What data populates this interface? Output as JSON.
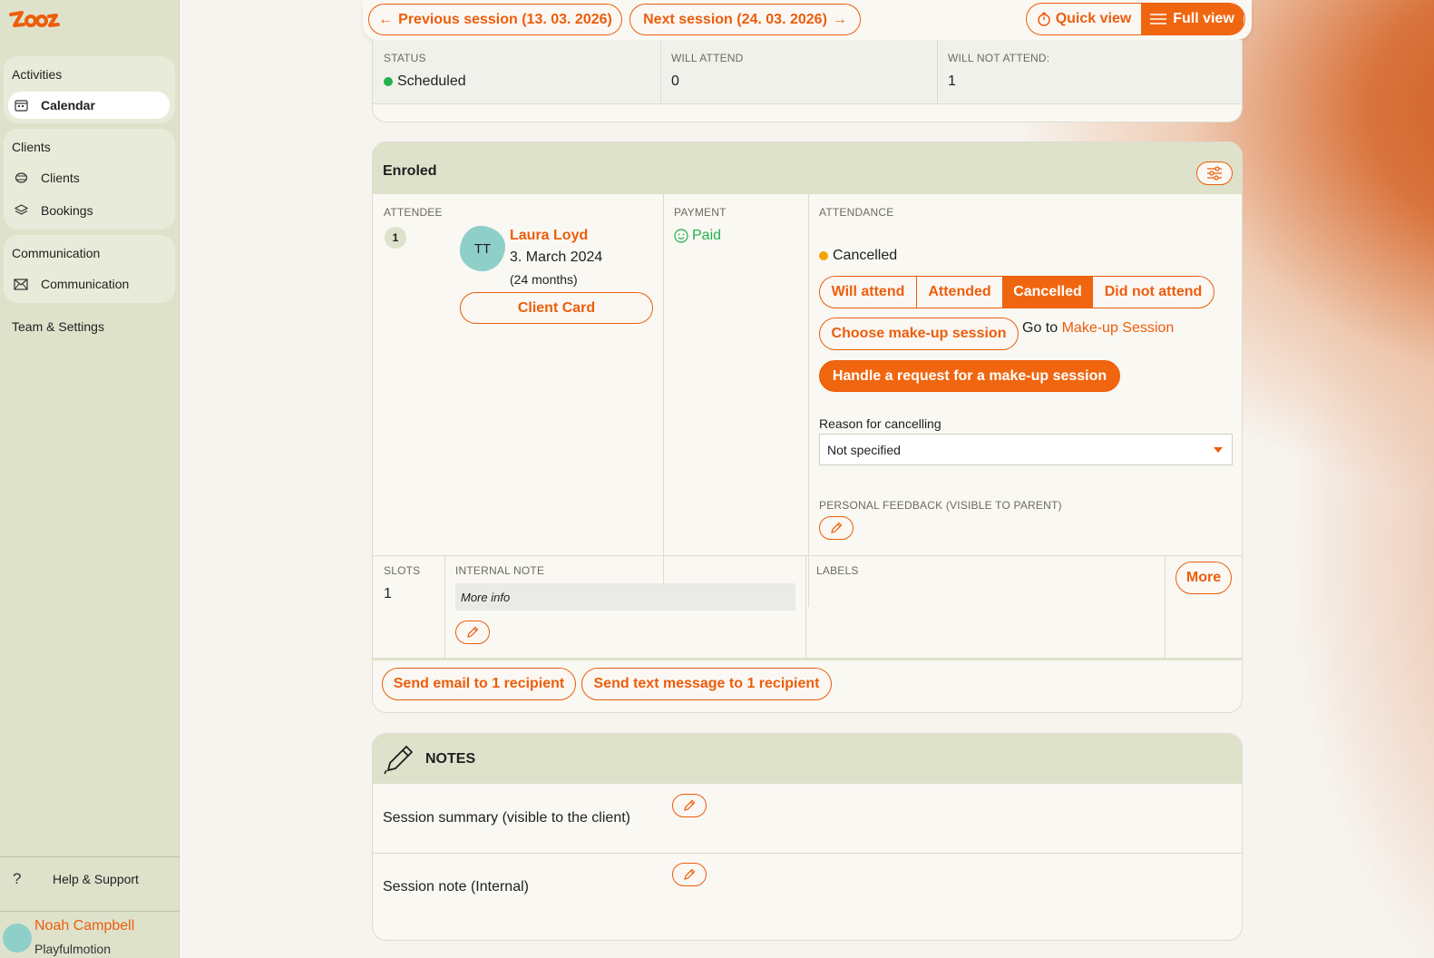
{
  "sidebar": {
    "logo_text": "zooza",
    "groups": [
      {
        "title": "Activities",
        "items": [
          {
            "label": "Calendar",
            "icon": "calendar-icon",
            "active": true
          }
        ]
      },
      {
        "title": "Clients",
        "items": [
          {
            "label": "Clients",
            "icon": "clients-icon"
          },
          {
            "label": "Bookings",
            "icon": "layers-icon"
          }
        ]
      },
      {
        "title": "Communication",
        "items": [
          {
            "label": "Communication",
            "icon": "envelope-icon"
          }
        ]
      }
    ],
    "team_settings": "Team & Settings",
    "help": "Help & Support",
    "user": {
      "name": "Noah Campbell",
      "org": "Playfulmotion"
    }
  },
  "topbar": {
    "prev_session": "Previous session (13. 03. 2026)",
    "next_session": "Next session (24. 03. 2026)",
    "quick_view": "Quick view",
    "full_view": "Full view"
  },
  "summary": {
    "status_label": "STATUS",
    "status_value": "Scheduled",
    "will_attend_label": "WILL ATTEND",
    "will_attend_value": "0",
    "will_not_attend_label": "WILL NOT ATTEND:",
    "will_not_attend_value": "1"
  },
  "enroled": {
    "title": "Enroled",
    "attendee_label": "ATTENDEE",
    "payment_label": "PAYMENT",
    "attendance_label": "ATTENDANCE",
    "attendee": {
      "index": "1",
      "initials": "TT",
      "name": "Laura Loyd",
      "birthdate": "3. March 2024",
      "age": "(24 months)",
      "client_card": "Client Card"
    },
    "payment_status": "Paid",
    "attendance_status": "Cancelled",
    "attendance_options": [
      "Will attend",
      "Attended",
      "Cancelled",
      "Did not attend"
    ],
    "attendance_selected": "Cancelled",
    "choose_makeup": "Choose make-up session",
    "goto_prefix": "Go to",
    "goto_link": "Make-up Session",
    "handle_request": "Handle a request for a make-up session",
    "reason_label": "Reason for cancelling",
    "reason_value": "Not specified",
    "feedback_label": "PERSONAL FEEDBACK (VISIBLE TO PARENT)",
    "slots_label": "SLOTS",
    "slots_value": "1",
    "internal_note_label": "INTERNAL NOTE",
    "internal_note_value": "More info",
    "labels_label": "LABELS",
    "more": "More",
    "send_email": "Send email to 1 recipient",
    "send_text": "Send text message to 1 recipient"
  },
  "notes": {
    "title": "NOTES",
    "session_summary": "Session summary (visible to the client)",
    "session_note": "Session note (Internal)"
  },
  "colors": {
    "accent": "#ec5d0c",
    "sidebar": "#dfe2cb",
    "success": "#22b14c",
    "warning": "#f5a300"
  }
}
